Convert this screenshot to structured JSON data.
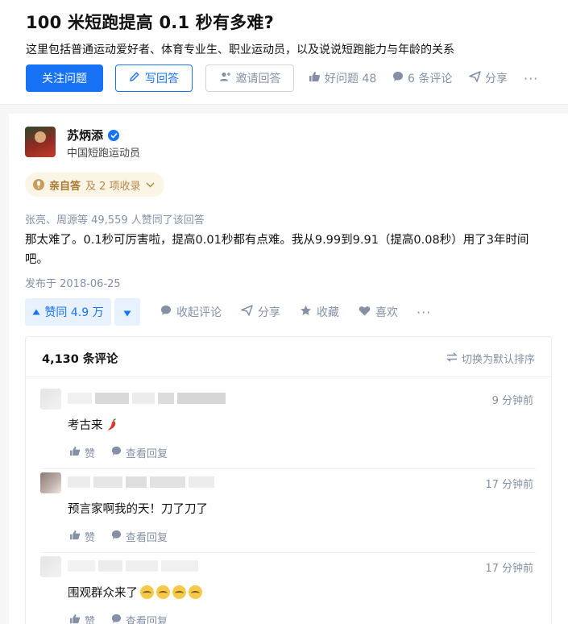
{
  "question": {
    "title": "100 米短跑提高 0.1 秒有多难?",
    "detail": "这里包括普通运动爱好者、体育专业生、职业运动员，以及说说短跑能力与年龄的关系",
    "follow_label": "关注问题",
    "write_label": "写回答",
    "invite_label": "邀请回答",
    "good_question_label": "好问题 48",
    "comments_label": "6 条评论",
    "share_label": "分享",
    "more_label": "···"
  },
  "answer": {
    "author_name": "苏炳添",
    "author_headline": "中国短跑运动员",
    "badge_primary": "亲自答",
    "badge_secondary": "及 2 项收录",
    "voters": "张亮、周源等 49,559 人赞同了该回答",
    "content": "那太难了。0.1秒可厉害啦，提高0.01秒都有点难。我从9.99到9.91（提高0.08秒）用了3年时间吧。",
    "published": "发布于 2018-06-25",
    "vote_up_label": "赞同 4.9 万",
    "collapse_comments_label": "收起评论",
    "share_label": "分享",
    "favorite_label": "收藏",
    "like_label": "喜欢",
    "more_label": "···"
  },
  "comments": {
    "count_label": "4,130 条评论",
    "sort_label": "切换为默认排序",
    "items": [
      {
        "time": "9 分钟前",
        "text": "考古来",
        "emoji": "chili-icon",
        "like_label": "赞",
        "reply_label": "查看回复"
      },
      {
        "time": "17 分钟前",
        "text": "预言家啊我的天！刀了刀了",
        "like_label": "赞",
        "reply_label": "查看回复"
      },
      {
        "time": "17 分钟前",
        "text": "围观群众来了",
        "emoji": "laughing-face-icon x4",
        "like_label": "赞",
        "reply_label": "查看回复"
      }
    ]
  },
  "colors": {
    "brand_blue": "#1772f6",
    "secondary_text": "#8590a6",
    "badge_gold": "#b4874a"
  }
}
